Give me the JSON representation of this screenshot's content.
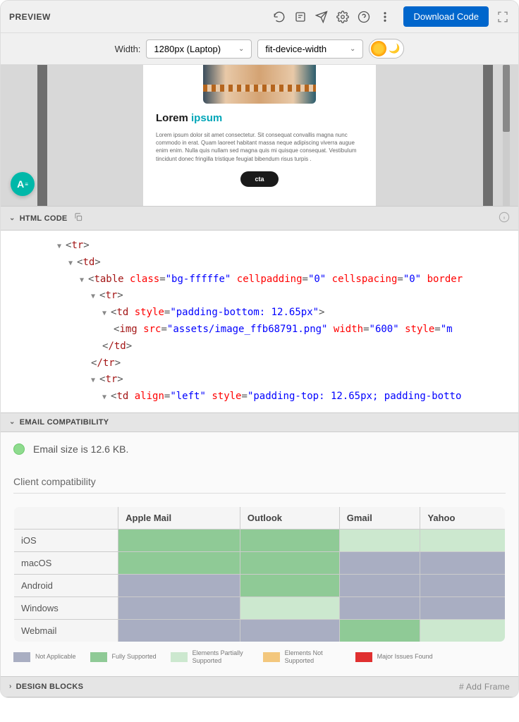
{
  "header": {
    "title": "PREVIEW",
    "download": "Download Code"
  },
  "widthBar": {
    "label": "Width:",
    "widthSelect": "1280px (Laptop)",
    "fitSelect": "fit-device-width"
  },
  "mock": {
    "h_w1": "Lorem ",
    "h_w2": "ipsum",
    "para": "Lorem ipsum dolor sit amet consectetur. Sit consequat convallis magna nunc commodo in erat. Quam laoreet habitant massa neque adipiscing viverra augue enim enim. Nulla quis nullam sed magna quis mi quisque consequat. Vestibulum tincidunt donec fringilla tristique feugiat bibendum risus turpis .",
    "cta": "cta",
    "fab": "A"
  },
  "sections": {
    "htmlCode": "HTML CODE",
    "emailCompat": "EMAIL COMPATIBILITY",
    "designBlocks": "DESIGN BLOCKS",
    "addFrame": "# Add Frame"
  },
  "code": {
    "l1_tag": "tr",
    "l2_tag": "td",
    "l3_tag": "table",
    "l3_a1": "class",
    "l3_v1": "\"bg-fffffe\"",
    "l3_a2": "cellpadding",
    "l3_v2": "\"0\"",
    "l3_a3": "cellspacing",
    "l3_v3": "\"0\"",
    "l3_a4": "border",
    "l4_tag": "tr",
    "l5_tag": "td",
    "l5_a1": "style",
    "l5_v1": "\"padding-bottom: 12.65px\"",
    "l6_tag": "img",
    "l6_a1": "src",
    "l6_v1": "\"assets/image_ffb68791.png\"",
    "l6_a2": "width",
    "l6_v2": "\"600\"",
    "l6_a3": "style",
    "l6_v3": "\"m",
    "l7_tag": "/td",
    "l8_tag": "/tr",
    "l9_tag": "tr",
    "l10_tag": "td",
    "l10_a1": "align",
    "l10_v1": "\"left\"",
    "l10_a2": "style",
    "l10_v2": "\"padding-top: 12.65px; padding-botto"
  },
  "compat": {
    "sizeText": "Email size is 12.6 KB.",
    "title": "Client compatibility",
    "cols": [
      "Apple Mail",
      "Outlook",
      "Gmail",
      "Yahoo"
    ],
    "rows": [
      "iOS",
      "macOS",
      "Android",
      "Windows",
      "Webmail"
    ],
    "legend": {
      "na": "Not Applicable",
      "full": "Fully Supported",
      "part": "Elements Partially Supported",
      "not": "Elements Not Supported",
      "major": "Major Issues Found"
    },
    "matrix": [
      [
        "c-na",
        "c-full",
        "c-full",
        "c-part",
        "c-part"
      ],
      [
        "c-na",
        "c-full",
        "c-full",
        "c-na",
        "c-na"
      ],
      [
        "c-na",
        "c-na",
        "c-full",
        "c-na",
        "c-na"
      ],
      [
        "c-na",
        "c-na",
        "c-part",
        "c-na",
        "c-na"
      ],
      [
        "c-na",
        "c-na",
        "c-na",
        "c-full",
        "c-part"
      ]
    ]
  }
}
